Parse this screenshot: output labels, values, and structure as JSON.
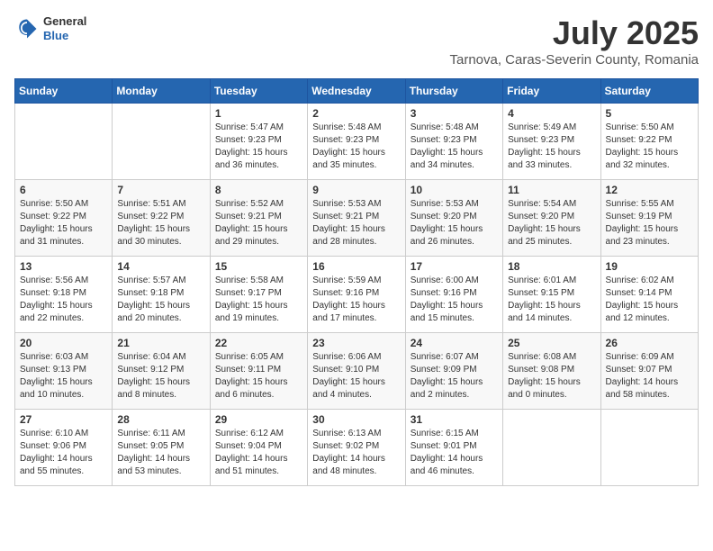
{
  "header": {
    "logo": {
      "general": "General",
      "blue": "Blue"
    },
    "title": "July 2025",
    "subtitle": "Tarnova, Caras-Severin County, Romania"
  },
  "calendar": {
    "days_of_week": [
      "Sunday",
      "Monday",
      "Tuesday",
      "Wednesday",
      "Thursday",
      "Friday",
      "Saturday"
    ],
    "weeks": [
      [
        {
          "day": "",
          "info": ""
        },
        {
          "day": "",
          "info": ""
        },
        {
          "day": "1",
          "info": "Sunrise: 5:47 AM\nSunset: 9:23 PM\nDaylight: 15 hours\nand 36 minutes."
        },
        {
          "day": "2",
          "info": "Sunrise: 5:48 AM\nSunset: 9:23 PM\nDaylight: 15 hours\nand 35 minutes."
        },
        {
          "day": "3",
          "info": "Sunrise: 5:48 AM\nSunset: 9:23 PM\nDaylight: 15 hours\nand 34 minutes."
        },
        {
          "day": "4",
          "info": "Sunrise: 5:49 AM\nSunset: 9:23 PM\nDaylight: 15 hours\nand 33 minutes."
        },
        {
          "day": "5",
          "info": "Sunrise: 5:50 AM\nSunset: 9:22 PM\nDaylight: 15 hours\nand 32 minutes."
        }
      ],
      [
        {
          "day": "6",
          "info": "Sunrise: 5:50 AM\nSunset: 9:22 PM\nDaylight: 15 hours\nand 31 minutes."
        },
        {
          "day": "7",
          "info": "Sunrise: 5:51 AM\nSunset: 9:22 PM\nDaylight: 15 hours\nand 30 minutes."
        },
        {
          "day": "8",
          "info": "Sunrise: 5:52 AM\nSunset: 9:21 PM\nDaylight: 15 hours\nand 29 minutes."
        },
        {
          "day": "9",
          "info": "Sunrise: 5:53 AM\nSunset: 9:21 PM\nDaylight: 15 hours\nand 28 minutes."
        },
        {
          "day": "10",
          "info": "Sunrise: 5:53 AM\nSunset: 9:20 PM\nDaylight: 15 hours\nand 26 minutes."
        },
        {
          "day": "11",
          "info": "Sunrise: 5:54 AM\nSunset: 9:20 PM\nDaylight: 15 hours\nand 25 minutes."
        },
        {
          "day": "12",
          "info": "Sunrise: 5:55 AM\nSunset: 9:19 PM\nDaylight: 15 hours\nand 23 minutes."
        }
      ],
      [
        {
          "day": "13",
          "info": "Sunrise: 5:56 AM\nSunset: 9:18 PM\nDaylight: 15 hours\nand 22 minutes."
        },
        {
          "day": "14",
          "info": "Sunrise: 5:57 AM\nSunset: 9:18 PM\nDaylight: 15 hours\nand 20 minutes."
        },
        {
          "day": "15",
          "info": "Sunrise: 5:58 AM\nSunset: 9:17 PM\nDaylight: 15 hours\nand 19 minutes."
        },
        {
          "day": "16",
          "info": "Sunrise: 5:59 AM\nSunset: 9:16 PM\nDaylight: 15 hours\nand 17 minutes."
        },
        {
          "day": "17",
          "info": "Sunrise: 6:00 AM\nSunset: 9:16 PM\nDaylight: 15 hours\nand 15 minutes."
        },
        {
          "day": "18",
          "info": "Sunrise: 6:01 AM\nSunset: 9:15 PM\nDaylight: 15 hours\nand 14 minutes."
        },
        {
          "day": "19",
          "info": "Sunrise: 6:02 AM\nSunset: 9:14 PM\nDaylight: 15 hours\nand 12 minutes."
        }
      ],
      [
        {
          "day": "20",
          "info": "Sunrise: 6:03 AM\nSunset: 9:13 PM\nDaylight: 15 hours\nand 10 minutes."
        },
        {
          "day": "21",
          "info": "Sunrise: 6:04 AM\nSunset: 9:12 PM\nDaylight: 15 hours\nand 8 minutes."
        },
        {
          "day": "22",
          "info": "Sunrise: 6:05 AM\nSunset: 9:11 PM\nDaylight: 15 hours\nand 6 minutes."
        },
        {
          "day": "23",
          "info": "Sunrise: 6:06 AM\nSunset: 9:10 PM\nDaylight: 15 hours\nand 4 minutes."
        },
        {
          "day": "24",
          "info": "Sunrise: 6:07 AM\nSunset: 9:09 PM\nDaylight: 15 hours\nand 2 minutes."
        },
        {
          "day": "25",
          "info": "Sunrise: 6:08 AM\nSunset: 9:08 PM\nDaylight: 15 hours\nand 0 minutes."
        },
        {
          "day": "26",
          "info": "Sunrise: 6:09 AM\nSunset: 9:07 PM\nDaylight: 14 hours\nand 58 minutes."
        }
      ],
      [
        {
          "day": "27",
          "info": "Sunrise: 6:10 AM\nSunset: 9:06 PM\nDaylight: 14 hours\nand 55 minutes."
        },
        {
          "day": "28",
          "info": "Sunrise: 6:11 AM\nSunset: 9:05 PM\nDaylight: 14 hours\nand 53 minutes."
        },
        {
          "day": "29",
          "info": "Sunrise: 6:12 AM\nSunset: 9:04 PM\nDaylight: 14 hours\nand 51 minutes."
        },
        {
          "day": "30",
          "info": "Sunrise: 6:13 AM\nSunset: 9:02 PM\nDaylight: 14 hours\nand 48 minutes."
        },
        {
          "day": "31",
          "info": "Sunrise: 6:15 AM\nSunset: 9:01 PM\nDaylight: 14 hours\nand 46 minutes."
        },
        {
          "day": "",
          "info": ""
        },
        {
          "day": "",
          "info": ""
        }
      ]
    ]
  }
}
